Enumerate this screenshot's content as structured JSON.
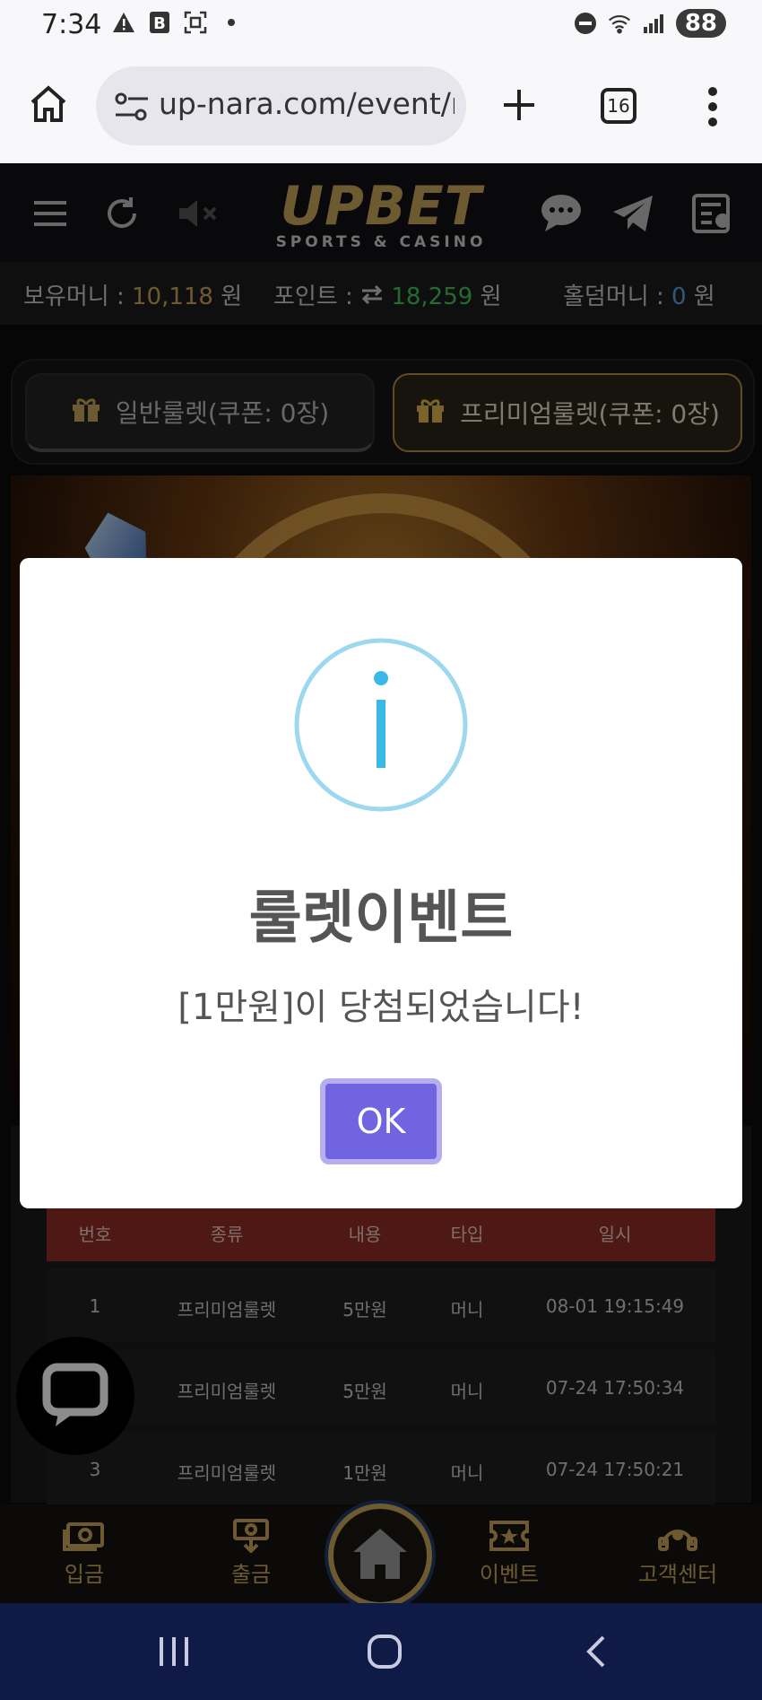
{
  "status_bar": {
    "time": "7:34",
    "battery": "88"
  },
  "browser": {
    "url": "up-nara.com/event/r",
    "tab_count": "16"
  },
  "site": {
    "logo_main": "UPBET",
    "logo_sub": "SPORTS & CASINO"
  },
  "balances": {
    "money_label": "보유머니 :",
    "money_value": "10,118",
    "money_unit": "원",
    "point_label": "포인트 :",
    "point_value": "18,259",
    "point_unit": "원",
    "holdem_label": "홀덤머니 :",
    "holdem_value": "0",
    "holdem_unit": "원"
  },
  "roulette_tabs": [
    {
      "label": "일반룰렛(쿠폰: 0장)"
    },
    {
      "label": "프리미엄룰렛(쿠폰: 0장)"
    }
  ],
  "history_table": {
    "headers": [
      "번호",
      "종류",
      "내용",
      "타입",
      "일시"
    ],
    "rows": [
      [
        "1",
        "프리미엄룰렛",
        "5만원",
        "머니",
        "08-01 19:15:49"
      ],
      [
        "",
        "프리미엄룰렛",
        "5만원",
        "머니",
        "07-24 17:50:34"
      ],
      [
        "3",
        "프리미엄룰렛",
        "1만원",
        "머니",
        "07-24 17:50:21"
      ]
    ]
  },
  "bottom_nav": [
    {
      "label": "입금",
      "icon": "deposit-icon"
    },
    {
      "label": "출금",
      "icon": "withdraw-icon"
    },
    {
      "label": "",
      "icon": "home-icon"
    },
    {
      "label": "이벤트",
      "icon": "event-ticket-icon"
    },
    {
      "label": "고객센터",
      "icon": "support-icon"
    }
  ],
  "modal": {
    "title": "룰렛이벤트",
    "message": "[1만원]이 당첨되었습니다!",
    "ok_label": "OK",
    "icon": "info-icon"
  },
  "colors": {
    "accent_gold": "#c7a45a",
    "point_green": "#43c35a",
    "ok_button": "#7164e0",
    "table_header": "#8f2d26"
  }
}
